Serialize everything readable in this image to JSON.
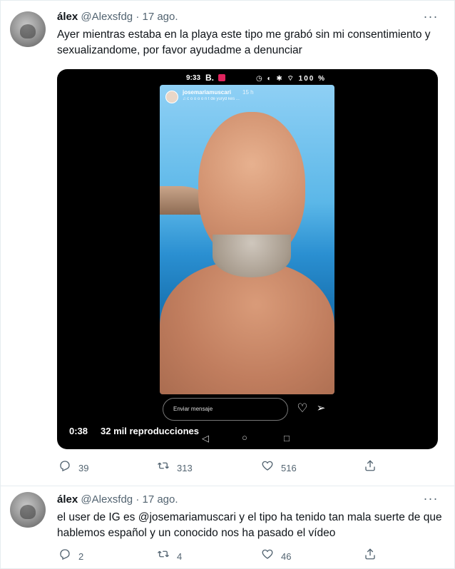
{
  "tweets": [
    {
      "name": "álex",
      "handle": "@Alexsfdg",
      "separator": "·",
      "date": "17 ago.",
      "text": "Ayer mientras estaba en la playa este tipo me grabó sin mi consentimiento y sexualizandome, por favor ayudadme a denunciar",
      "media": {
        "status_time": "9:33",
        "status_app": "B.",
        "status_icons": "◷ ◐ ✱ ⌔ 100 %",
        "story_username": "josemariamuscari",
        "story_time": "15 h",
        "story_song": "♫ c o o o o n t  de yuryd kes ...",
        "message_placeholder": "Enviar mensaje",
        "duration": "0:38",
        "views": "32 mil reproducciones"
      },
      "replies": "39",
      "retweets": "313",
      "likes": "516"
    },
    {
      "name": "álex",
      "handle": "@Alexsfdg",
      "separator": "·",
      "date": "17 ago.",
      "text": "el user de IG es @josemariamuscari y el tipo ha tenido tan mala suerte de que hablemos español y un conocido nos ha pasado el vídeo",
      "replies": "2",
      "retweets": "4",
      "likes": "46"
    }
  ],
  "icons": {
    "more": "more-horizontal-icon",
    "reply": "reply-icon",
    "retweet": "retweet-icon",
    "like": "heart-icon",
    "share": "share-icon"
  }
}
